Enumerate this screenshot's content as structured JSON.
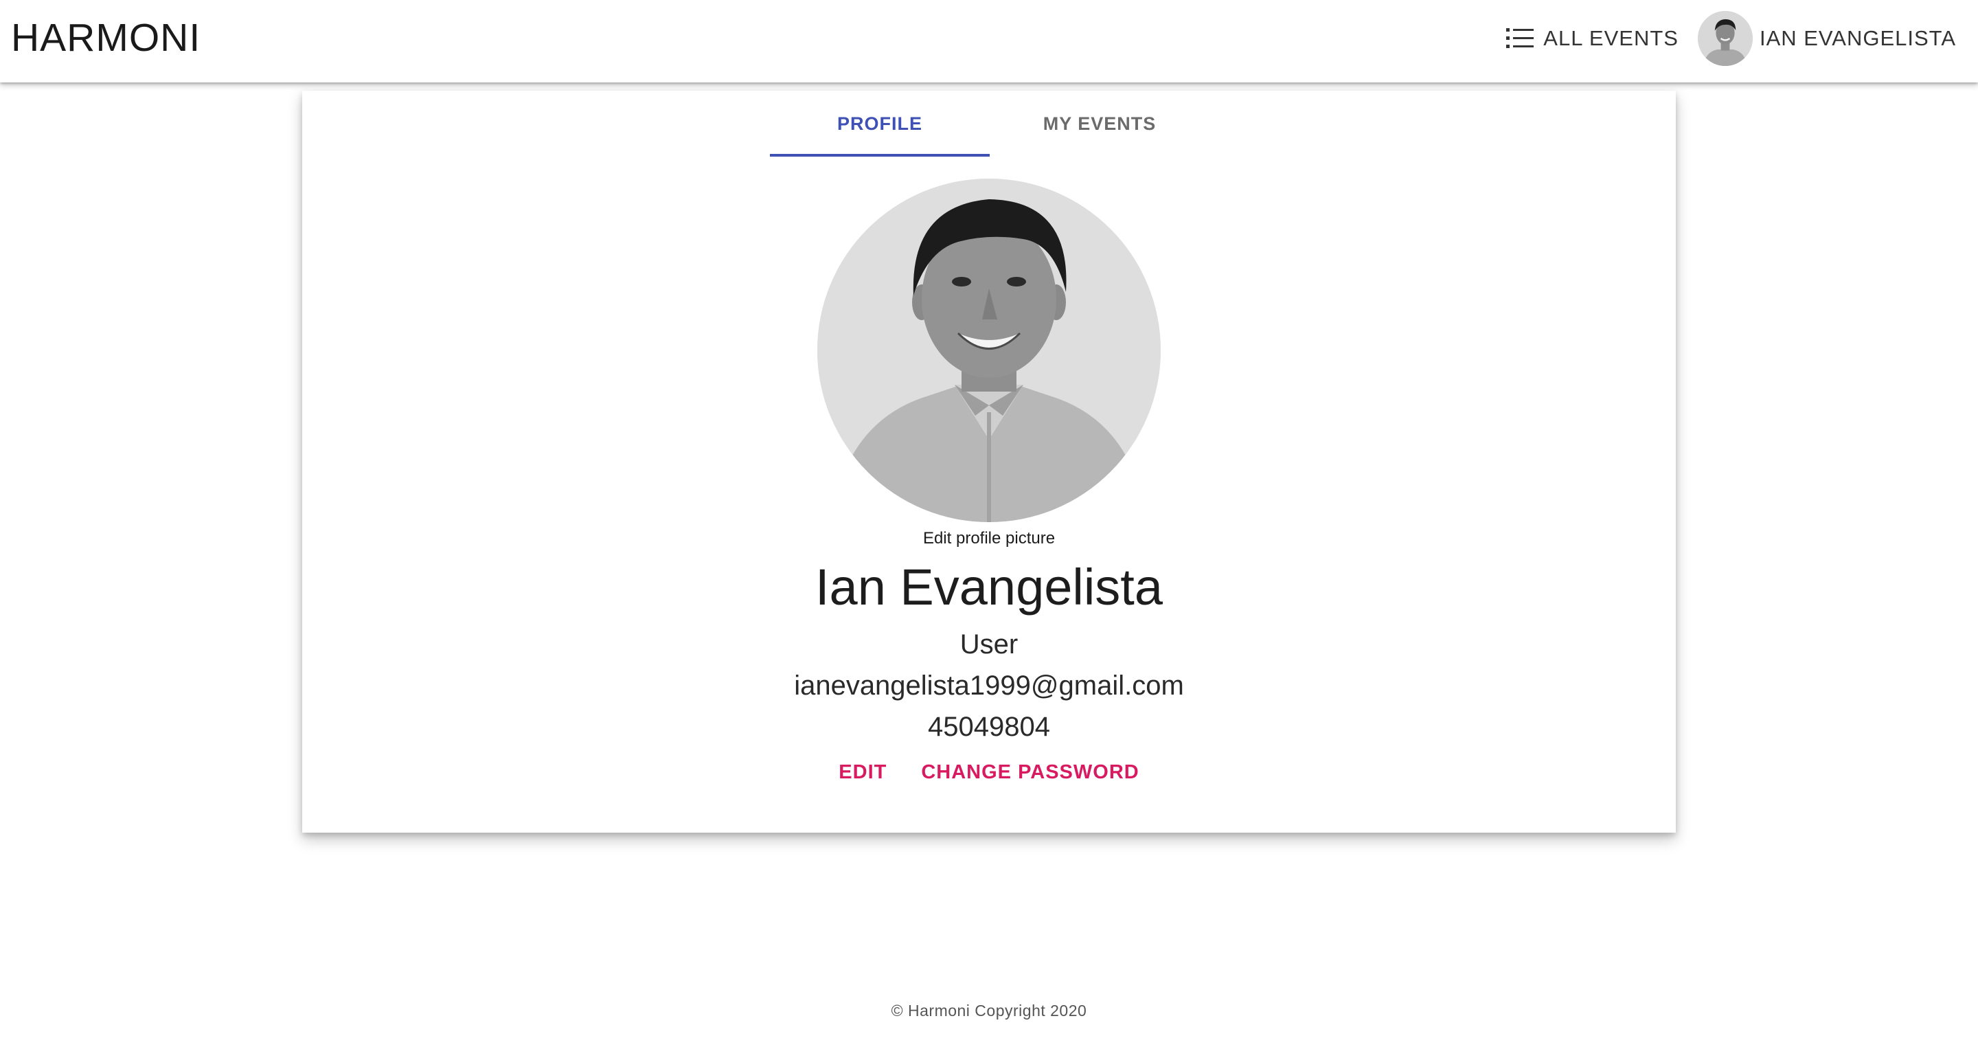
{
  "app": {
    "brand": "HARMONI"
  },
  "header": {
    "all_events_label": "ALL EVENTS",
    "all_events_icon": "list-icon",
    "user_name": "IAN EVANGELISTA"
  },
  "tabs": [
    {
      "label": "PROFILE",
      "active": true
    },
    {
      "label": "MY EVENTS",
      "active": false
    }
  ],
  "profile": {
    "edit_picture_label": "Edit profile picture",
    "full_name": "Ian Evangelista",
    "role": "User",
    "email": "ianevangelista1999@gmail.com",
    "phone": "45049804"
  },
  "actions": {
    "edit_label": "EDIT",
    "change_password_label": "CHANGE PASSWORD"
  },
  "footer": {
    "copyright": "© Harmoni Copyright 2020"
  },
  "colors": {
    "primary": "#3f51b5",
    "accent": "#d81b60"
  }
}
